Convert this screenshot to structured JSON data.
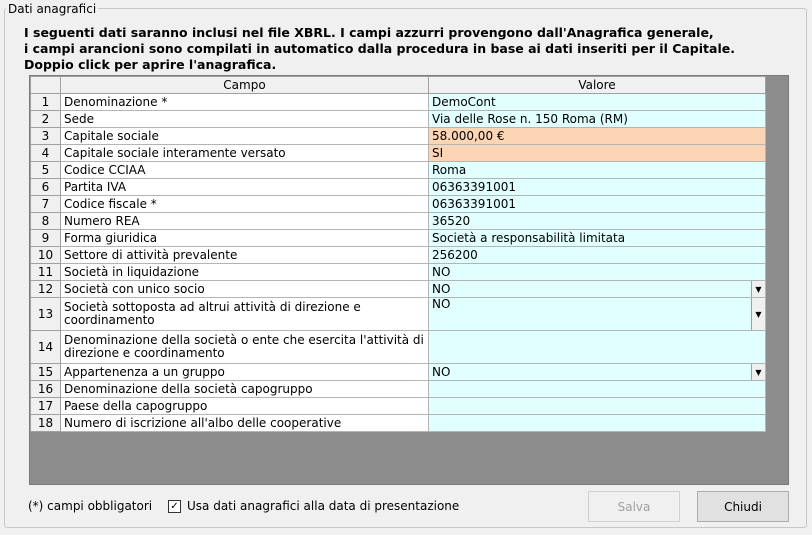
{
  "group_title": "Dati anagrafici",
  "intro": [
    "I seguenti dati saranno inclusi nel file XBRL. I campi azzurri provengono dall'Anagrafica generale,",
    "i campi arancioni sono compilati in automatico dalla procedura in base ai dati inseriti per il Capitale.",
    "Doppio click per aprire l'anagrafica."
  ],
  "table": {
    "headers": [
      "Campo",
      "Valore"
    ],
    "rows": [
      {
        "n": "1",
        "campo": "Denominazione *",
        "valore": "DemoCont",
        "color": "blue",
        "dropdown": false,
        "tall": false
      },
      {
        "n": "2",
        "campo": "Sede",
        "valore": "Via delle Rose n. 150 Roma (RM)",
        "color": "blue",
        "dropdown": false,
        "tall": false
      },
      {
        "n": "3",
        "campo": "Capitale sociale",
        "valore": "58.000,00 €",
        "color": "orange",
        "dropdown": false,
        "tall": false
      },
      {
        "n": "4",
        "campo": "Capitale sociale interamente versato",
        "valore": "SI",
        "color": "orange",
        "dropdown": false,
        "tall": false
      },
      {
        "n": "5",
        "campo": "Codice CCIAA",
        "valore": "Roma",
        "color": "blue",
        "dropdown": false,
        "tall": false
      },
      {
        "n": "6",
        "campo": "Partita IVA",
        "valore": "06363391001",
        "color": "blue",
        "dropdown": false,
        "tall": false
      },
      {
        "n": "7",
        "campo": "Codice fiscale *",
        "valore": "06363391001",
        "color": "blue",
        "dropdown": false,
        "tall": false
      },
      {
        "n": "8",
        "campo": "Numero REA",
        "valore": "36520",
        "color": "blue",
        "dropdown": false,
        "tall": false
      },
      {
        "n": "9",
        "campo": "Forma giuridica",
        "valore": "Società a responsabilità limitata",
        "color": "blue",
        "dropdown": false,
        "tall": false
      },
      {
        "n": "10",
        "campo": "Settore di attività prevalente",
        "valore": "256200",
        "color": "blue",
        "dropdown": false,
        "tall": false
      },
      {
        "n": "11",
        "campo": "Società in liquidazione",
        "valore": "NO",
        "color": "blue",
        "dropdown": false,
        "tall": false
      },
      {
        "n": "12",
        "campo": "Società con unico socio",
        "valore": "NO",
        "color": "blue",
        "dropdown": true,
        "tall": false
      },
      {
        "n": "13",
        "campo": "Società sottoposta ad altrui attività di direzione e coordinamento",
        "valore": "NO",
        "color": "blue",
        "dropdown": true,
        "tall": true
      },
      {
        "n": "14",
        "campo": "Denominazione della società o ente che esercita l'attività di direzione e coordinamento",
        "valore": "",
        "color": "blue",
        "dropdown": false,
        "tall": true
      },
      {
        "n": "15",
        "campo": "Appartenenza a un gruppo",
        "valore": "NO",
        "color": "blue",
        "dropdown": true,
        "tall": false
      },
      {
        "n": "16",
        "campo": "Denominazione della società capogruppo",
        "valore": "",
        "color": "blue",
        "dropdown": false,
        "tall": false
      },
      {
        "n": "17",
        "campo": "Paese della capogruppo",
        "valore": "",
        "color": "blue",
        "dropdown": false,
        "tall": false
      },
      {
        "n": "18",
        "campo": "Numero di iscrizione all'albo delle cooperative",
        "valore": "",
        "color": "blue",
        "dropdown": false,
        "tall": false
      }
    ]
  },
  "footnote": "(*) campi obbligatori",
  "checkbox": {
    "label": "Usa dati anagrafici alla data di presentazione",
    "checked": true,
    "mark": "✓"
  },
  "buttons": {
    "salva": "Salva",
    "chiudi": "Chiudi"
  },
  "icons": {
    "dropdown": "▼"
  }
}
